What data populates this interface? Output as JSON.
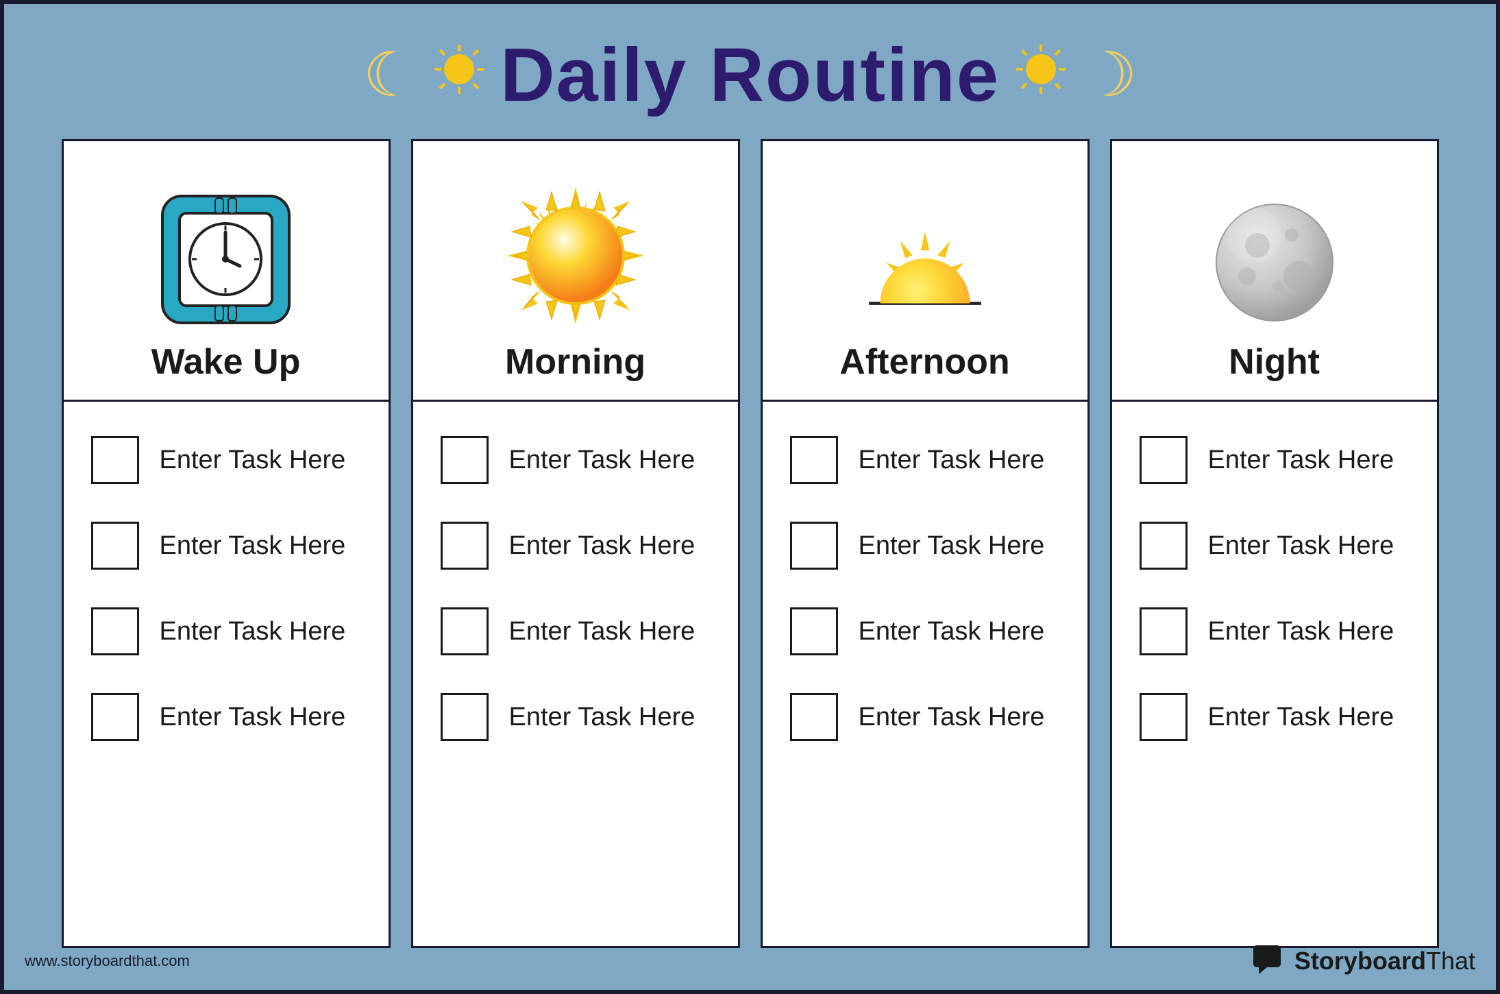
{
  "header": {
    "title": "Daily Routine",
    "url": "www.storyboardthat.com",
    "brand": "StoryboardThat"
  },
  "columns": [
    {
      "id": "wake-up",
      "title": "Wake Up",
      "icon_type": "clock",
      "tasks": [
        "Enter Task Here",
        "Enter Task Here",
        "Enter Task Here",
        "Enter Task Here"
      ]
    },
    {
      "id": "morning",
      "title": "Morning",
      "icon_type": "sun",
      "tasks": [
        "Enter Task Here",
        "Enter Task Here",
        "Enter Task Here",
        "Enter Task Here"
      ]
    },
    {
      "id": "afternoon",
      "title": "Afternoon",
      "icon_type": "afternoon",
      "tasks": [
        "Enter Task Here",
        "Enter Task Here",
        "Enter Task Here",
        "Enter Task Here"
      ]
    },
    {
      "id": "night",
      "title": "Night",
      "icon_type": "moon",
      "tasks": [
        "Enter Task Here",
        "Enter Task Here",
        "Enter Task Here",
        "Enter Task Here"
      ]
    }
  ]
}
